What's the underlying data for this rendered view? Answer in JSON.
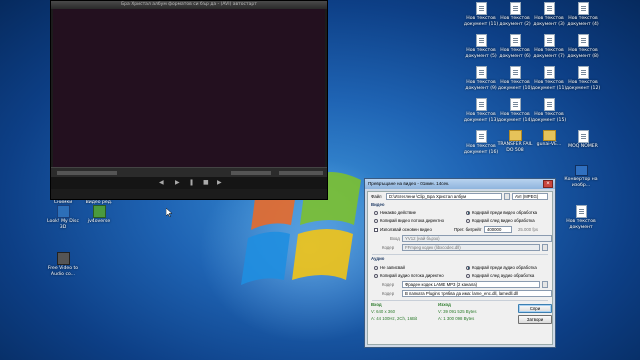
{
  "player": {
    "title": "Бра Христал албум форматов си бър да - (AVI) автостарт"
  },
  "desktop": {
    "left_icons": [
      {
        "label": "Снимки",
        "type": "app3"
      },
      {
        "label": "Видео ред.",
        "type": "app3"
      },
      {
        "label": "Look! My Disc 3D",
        "type": "app"
      },
      {
        "label": "jv4oversе",
        "type": "app2"
      },
      {
        "label": "Free Video to Audio co...",
        "type": "app3"
      }
    ],
    "right_icons": [
      [
        "Нов текстов документ (11)",
        "Нов текстов документ (2)",
        "Нов текстов документ (3)",
        "Нов текстов документ (4)"
      ],
      [
        "Нов текстов документ (5)",
        "Нов текстов документ (6)",
        "Нов текстов документ (7)",
        "Нов текстов документ (8)"
      ],
      [
        "Нов текстов документ (9)",
        "Нов текстов документ (10)",
        "Нов текстов документ (11)",
        "Нов текстов документ (12)"
      ],
      [
        "Нов текстов документ (13)",
        "Нов текстов документ (14)",
        "Нов текстов документ (15)"
      ],
      [
        "Нов текстов документ (16)",
        "TRANSFER FAIL DO 508",
        "gunai-VE...",
        "MOQ NOMER"
      ]
    ],
    "right_single": [
      {
        "label": "Конвертор на изобр...",
        "type": "conv"
      },
      {
        "label": "Нов текстов документ",
        "type": "doc"
      }
    ]
  },
  "dialog": {
    "title": "Превръщане на видео - 01мин. 14сек.",
    "file_label": "Файл",
    "file_value": "D:\\Изтеглени \\Clip_Бра Христал албум",
    "format_value": "AVI (MPEG)",
    "video_group": "Видео",
    "video_opt1": "Никакво действие",
    "video_opt2": "Копирай видео потока директно",
    "video_opt3": "Кодирай преди видео обработка",
    "video_opt4": "Кодирай след видео обработка",
    "video_chk": "Използвай основен видео",
    "bitrate_label": "Прет. битрейт",
    "bitrate_value": "400000",
    "fps_value": "25.000 fps",
    "input_label": "Вход",
    "codec_in": "YV12 (най бързо)",
    "codec_label": "Кодер",
    "codec_value": "FFmpeg кодек (libxcodec.dll)",
    "audio_group": "Аудио",
    "audio_opt1": "Не записвай",
    "audio_opt2": "Копирай аудио потока директно",
    "audio_opt3": "Кодирай преди аудио обработка",
    "audio_opt4": "Кодирай след аудио обработка",
    "audio_codec": "Фраден кодек LAME MP3 (2 канала)",
    "audio_plugin": "В папката Plugins трябва да има: lame_enc.dll, lamedll.dll",
    "in_title": "Вход",
    "in_v": "V: 640 x 360",
    "in_a": "A: 44 100Hz, 2Ch, 16Bit",
    "out_title": "Изход",
    "out_v": "V: 39 091 525 Bytes",
    "out_a": "A: 1 300 098 Bytes",
    "stop_button": "Спри",
    "close_button": "Затвори"
  }
}
